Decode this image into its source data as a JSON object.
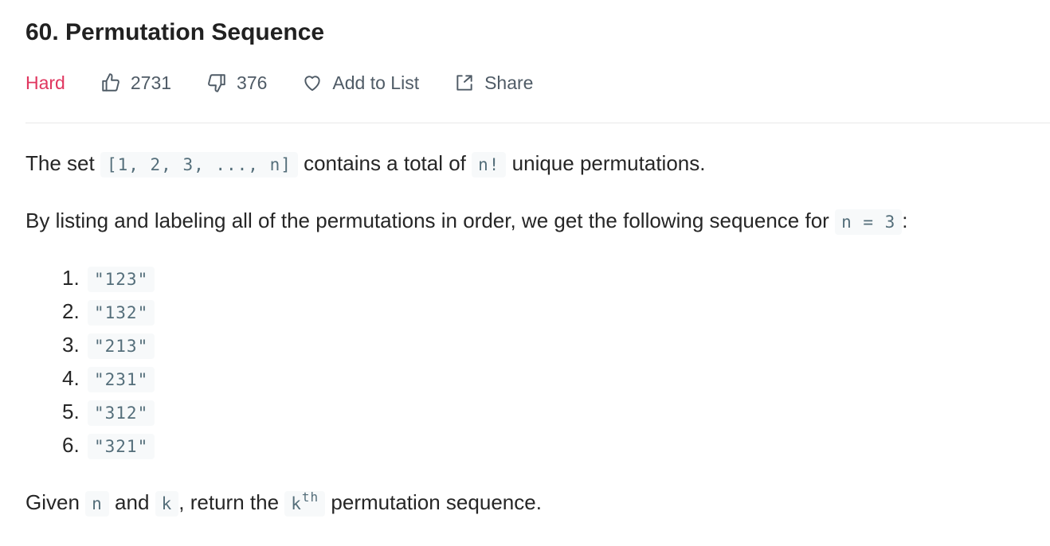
{
  "problem": {
    "title": "60. Permutation Sequence",
    "difficulty": "Hard",
    "likes": "2731",
    "dislikes": "376",
    "add_to_list": "Add to List",
    "share": "Share"
  },
  "description": {
    "p1": {
      "t1": "The set ",
      "c1": "[1, 2, 3, ..., n]",
      "t2": " contains a total of ",
      "c2": "n!",
      "t3": " unique permutations."
    },
    "p2": {
      "t1": "By listing and labeling all of the permutations in order, we get the following sequence for ",
      "c1": "n = 3",
      "t2": ":"
    },
    "list": [
      {
        "num": "1.",
        "value": "\"123\""
      },
      {
        "num": "2.",
        "value": "\"132\""
      },
      {
        "num": "3.",
        "value": "\"213\""
      },
      {
        "num": "4.",
        "value": "\"231\""
      },
      {
        "num": "5.",
        "value": "\"312\""
      },
      {
        "num": "6.",
        "value": "\"321\""
      }
    ],
    "p3": {
      "t1": "Given ",
      "c1": "n",
      "t2": " and ",
      "c2": "k",
      "t3": ", return the ",
      "c3": "k",
      "c3sup": "th",
      "t4": " permutation sequence."
    }
  },
  "icons": {
    "like": "thumbs-up-icon",
    "dislike": "thumbs-down-icon",
    "add": "heart-icon",
    "share": "share-icon"
  },
  "colors": {
    "difficulty": "#e0365f",
    "meta_text": "#4f5b66",
    "code_text": "#546e7a",
    "code_bg": "#f7f9fa"
  }
}
